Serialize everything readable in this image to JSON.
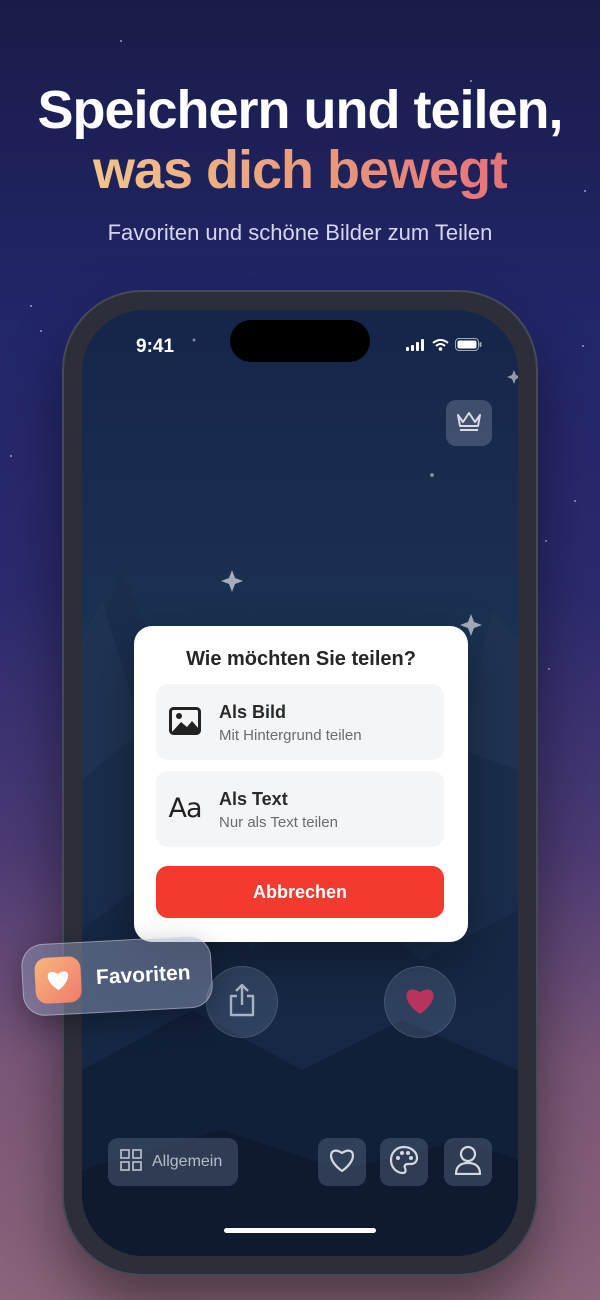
{
  "headline": {
    "line1": "Speichern und teilen,",
    "line2": "was dich bewegt",
    "subtitle": "Favoriten und schöne Bilder zum Teilen"
  },
  "status_bar": {
    "time": "9:41",
    "icons": [
      "signal-icon",
      "wifi-icon",
      "battery-icon"
    ]
  },
  "share_dialog": {
    "title": "Wie möchten Sie teilen?",
    "options": [
      {
        "icon": "image-icon",
        "title": "Als Bild",
        "subtitle": "Mit Hintergrund teilen"
      },
      {
        "icon": "text-icon",
        "glyph": "Aa",
        "title": "Als Text",
        "subtitle": "Nur als Text teilen"
      }
    ],
    "cancel_label": "Abbrechen"
  },
  "actions": [
    "share-icon",
    "heart-icon"
  ],
  "bottom_bar": {
    "category_label": "Allgemein",
    "buttons": [
      "heart-outline-icon",
      "palette-icon",
      "profile-icon"
    ]
  },
  "favorites_chip": {
    "label": "Favoriten",
    "icon": "heart-icon"
  },
  "colors": {
    "accent_red": "#f23a2f",
    "gradient_gold": "#f2c48a",
    "gradient_pink": "#e5727a",
    "heart": "#b8345f"
  }
}
